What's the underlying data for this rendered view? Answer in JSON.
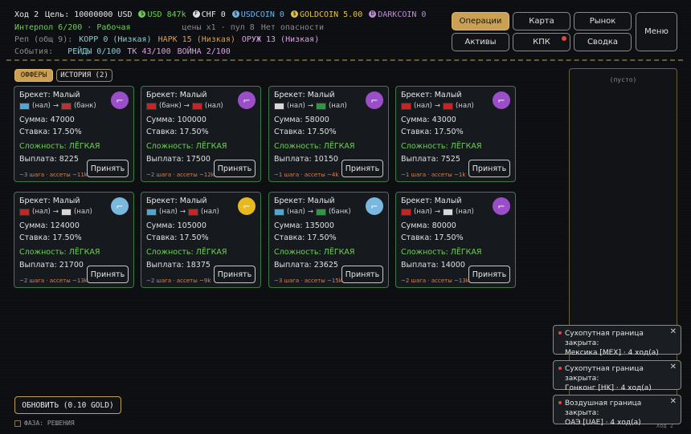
{
  "hud": {
    "turn": "Ход 2",
    "goal": "Цель: 10000000 USD",
    "usd": "USD 847k",
    "chf": "CHF 0",
    "usdcoin": "USDCOIN 0",
    "goldcoin": "GOLDCOIN 5.00",
    "darkcoin": "DARKCOIN 0",
    "interpol": "Интерпол 6/200 · Рабочая",
    "prices": "цены x1 · пул 8",
    "danger": "Нет опасности",
    "rep_label": "Реп (общ 9):",
    "korr": "КОРР 0 (Низкая)",
    "nark": "НАРК 15 (Низкая)",
    "oruzh": "ОРУЖ 13 (Низкая)",
    "events_label": "События:",
    "reidy": "РЕЙДЫ 0/100",
    "tk": "ТК 43/100",
    "voina": "ВОЙНА 2/100"
  },
  "menu": {
    "operations": "Операции",
    "map": "Карта",
    "market": "Рынок",
    "menu": "Меню",
    "assets": "Активы",
    "kpk": "КПК",
    "summary": "Сводка"
  },
  "tabs": {
    "offers": "ОФФЕРЫ",
    "history": "ИСТОРИЯ (2)"
  },
  "labels": {
    "accept": "Принять",
    "refresh": "ОБНОВИТЬ (0.10 GOLD)",
    "phase": "ФАЗА: РЕШЕНИЯ",
    "empty": "(пусто)",
    "turn_small": "Ход 2"
  },
  "cards": [
    {
      "title": "Брекет: Малый",
      "from": "(нал)",
      "to": "(банк)",
      "sum": "Сумма: 47000",
      "rate": "Ставка: 17.50%",
      "diff": "Сложность: ЛЁГКАЯ",
      "pay": "Выплата: 8225",
      "meta": "~3 шага · ассеты ~11k",
      "icon": "purple",
      "fa": "#4aa8d8",
      "fb": "#c03030"
    },
    {
      "title": "Брекет: Малый",
      "from": "(банк)",
      "to": "(нал)",
      "sum": "Сумма: 100000",
      "rate": "Ставка: 17.50%",
      "diff": "Сложность: ЛЁГКАЯ",
      "pay": "Выплата: 17500",
      "meta": "~2 шага · ассеты ~12k",
      "icon": "purple",
      "fa": "#d02020",
      "fb": "#d02020"
    },
    {
      "title": "Брекет: Малый",
      "from": "(нал)",
      "to": "(нал)",
      "sum": "Сумма: 58000",
      "rate": "Ставка: 17.50%",
      "diff": "Сложность: ЛЁГКАЯ",
      "pay": "Выплата: 10150",
      "meta": "~1 шага · ассеты ~4k",
      "icon": "purple",
      "fa": "#d8d8d8",
      "fb": "#2a9a40"
    },
    {
      "title": "Брекет: Малый",
      "from": "(нал)",
      "to": "(нал)",
      "sum": "Сумма: 43000",
      "rate": "Ставка: 17.50%",
      "diff": "Сложность: ЛЁГКАЯ",
      "pay": "Выплата: 7525",
      "meta": "~1 шага · ассеты ~1k",
      "icon": "purple",
      "fa": "#d02020",
      "fb": "#d02020"
    },
    {
      "title": "Брекет: Малый",
      "from": "(нал)",
      "to": "(нал)",
      "sum": "Сумма: 124000",
      "rate": "Ставка: 17.50%",
      "diff": "Сложность: ЛЁГКАЯ",
      "pay": "Выплата: 21700",
      "meta": "~2 шага · ассеты ~13k",
      "icon": "blue",
      "fa": "#d02020",
      "fb": "#d8d8d8"
    },
    {
      "title": "Брекет: Малый",
      "from": "(нал)",
      "to": "(нал)",
      "sum": "Сумма: 105000",
      "rate": "Ставка: 17.50%",
      "diff": "Сложность: ЛЁГКАЯ",
      "pay": "Выплата: 18375",
      "meta": "~2 шага · ассеты ~9k",
      "icon": "yellow",
      "fa": "#4aa8d8",
      "fb": "#d02020"
    },
    {
      "title": "Брекет: Малый",
      "from": "(нал)",
      "to": "(банк)",
      "sum": "Сумма: 135000",
      "rate": "Ставка: 17.50%",
      "diff": "Сложность: ЛЁГКАЯ",
      "pay": "Выплата: 23625",
      "meta": "~3 шага · ассеты ~15k",
      "icon": "blue",
      "fa": "#4aa8d8",
      "fb": "#2a9a40"
    },
    {
      "title": "Брекет: Малый",
      "from": "(нал)",
      "to": "(нал)",
      "sum": "Сумма: 80000",
      "rate": "Ставка: 17.50%",
      "diff": "Сложность: ЛЁГКАЯ",
      "pay": "Выплата: 14000",
      "meta": "~2 шага · ассеты ~13k",
      "icon": "purple",
      "fa": "#d02020",
      "fb": "#d8d8d8"
    }
  ],
  "notifications": [
    {
      "line1": "Сухопутная граница закрыта:",
      "line2": "Мексика [MEX] · 4 ход(а)"
    },
    {
      "line1": "Сухопутная граница закрыта:",
      "line2": "Гонконг [HK] · 4 ход(а)"
    },
    {
      "line1": "Воздушная граница закрыта:",
      "line2": "ОАЭ [UAE] · 4 ход(а)"
    }
  ],
  "colors": {
    "accent": "#c9a054",
    "green": "#6fcf57",
    "purple": "#9a4fc8",
    "blue": "#7ab8e0",
    "yellow": "#e8b820"
  }
}
